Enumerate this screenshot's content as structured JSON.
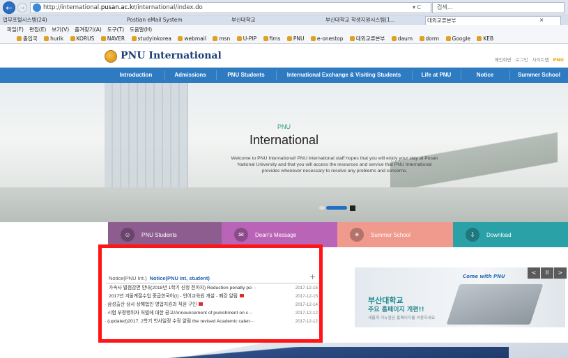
{
  "browser": {
    "url_prefix": "http://",
    "url_domain_pre": "international.",
    "url_domain": "pusan.ac.kr",
    "url_path": "/international/index.do",
    "url_ctrl": "▾ C",
    "search_placeholder": "검색...",
    "tabs": [
      {
        "label": "업무포털시스템(24)",
        "active": false
      },
      {
        "label": "Postian eMail System",
        "active": false
      },
      {
        "label": "부산대학교",
        "active": false
      },
      {
        "label": "부산대학교 학생지원시스템(1...",
        "active": false
      },
      {
        "label": "대외교류본부",
        "active": true
      },
      {
        "label": "×",
        "active": false
      }
    ],
    "menu": [
      "파일(F)",
      "편집(E)",
      "보기(V)",
      "즐겨찾기(A)",
      "도구(T)",
      "도움말(H)"
    ],
    "favorites": [
      "출입국",
      "hurik",
      "KORUS",
      "NAVER",
      "studyinkorea",
      "webmail",
      "msn",
      "U-PIP",
      "fims",
      "PNU",
      "e-onestop",
      "대외교류본부",
      "daum",
      "dorm",
      "Google",
      "KEB"
    ]
  },
  "site": {
    "logo_text": "PNU International",
    "util_links": [
      "배인화면",
      "로그인",
      "사이트맵"
    ],
    "util_brand": "PNU",
    "nav": [
      "Introduction",
      "Admissions",
      "PNU Students",
      "International Exchange & Visiting Students",
      "Life at PNU",
      "Notice",
      "Summer School"
    ]
  },
  "hero": {
    "subtitle": "PNU",
    "title": "International",
    "text": "Welcome to PNU International! PNU international staff hopes that you will enjoy your stay at Pusan National University and that you will access the resources and service that PNU International provides whenever necessary to resolve any problems and concerns."
  },
  "quick_links": [
    {
      "label": "PNU Students",
      "color": "#8d5d8f"
    },
    {
      "label": "Dean's Message",
      "color": "#b964b7"
    },
    {
      "label": "Summer School",
      "color": "#f09a8e"
    },
    {
      "label": "Download",
      "color": "#2aa0a7"
    }
  ],
  "notice": {
    "tab1": "Notice(PNU Int.)",
    "tab2": "Notice(PNU Int, student)",
    "more": "+",
    "rows": [
      {
        "title": "가속사 벌점감면 안내(2018년 1학기 신청 전까지) Reduction penalty po···",
        "date": "2017-12-15",
        "new": false
      },
      {
        "title": "2017년 겨울계절수업 중급한국어(I) - 언어교육원 개설 - 폐강 알림",
        "date": "2017-12-15",
        "new": true
      },
      {
        "title": "· 삼성출산 상사 상해법인 영업지원과 직원 구인",
        "date": "2017-12-14",
        "new": true
      },
      {
        "title": "· 시험 부정행위자 처벌에 대한 공고/Announcement of punishment on c···",
        "date": "2017-12-12",
        "new": false
      },
      {
        "title": "· (updated)2017. 2학기 학사일정 수정 알림 the revised Academic calen···",
        "date": "2017-12-12",
        "new": false
      }
    ]
  },
  "banner": {
    "logo": "Come with PNU",
    "title1": "부산대학교",
    "title2": "주요 홈페이지 개편!!",
    "desc": "새롭게 리뉴얼된 홈페이지를 이용하세요",
    "prev": "<",
    "pause": "II",
    "next": ">"
  },
  "colors": {
    "nav": "#2e7bc1",
    "highlight_frame": "#ff1515",
    "accent": "#1f6fc2"
  },
  "icons": [
    "back-icon",
    "forward-icon",
    "ie-icon",
    "student-icon",
    "message-icon",
    "sun-icon",
    "download-icon"
  ]
}
